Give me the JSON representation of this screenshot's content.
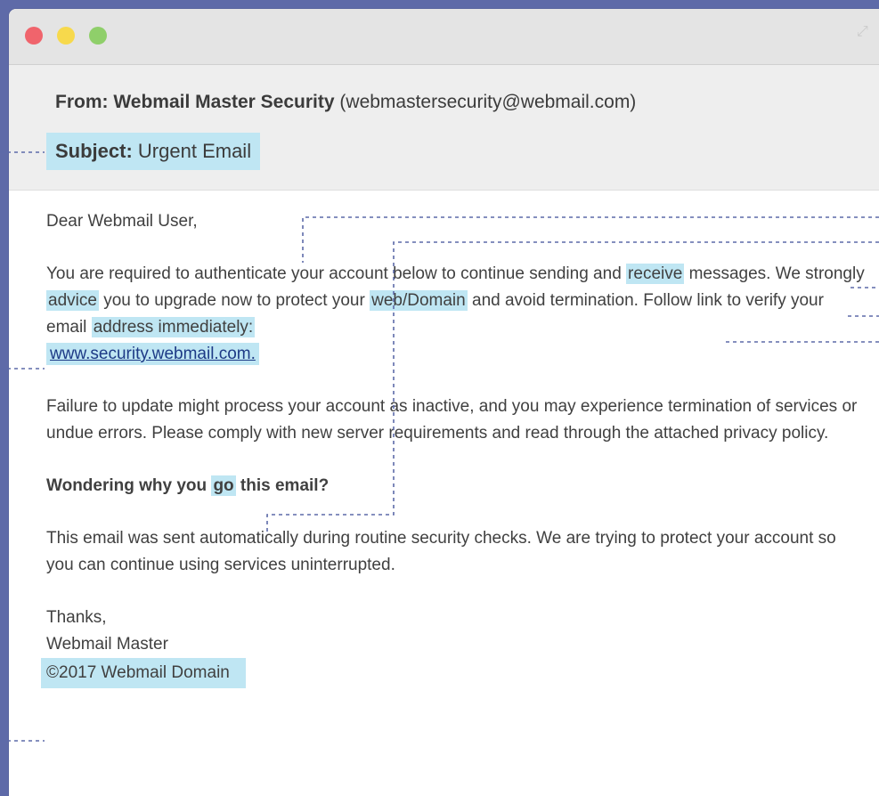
{
  "window": {
    "controls": {
      "close": "close-dot",
      "minimize": "minimize-dot",
      "zoom": "zoom-dot"
    }
  },
  "email": {
    "from_label": "From:",
    "from_name": "Webmail Master Security",
    "from_address": "(webmastersecurity@webmail.com)",
    "subject_label": "Subject:",
    "subject_value": "Urgent Email",
    "greeting": "Dear Webmail User,",
    "para1_a": "You are required to authenticate your account below to continue sending and ",
    "para1_hl1": "receive",
    "para1_b": " messages. We strongly ",
    "para1_hl2": "advice",
    "para1_c": " you to upgrade now to protect your ",
    "para1_hl3": "web/Domain",
    "para1_d": " and avoid termination. Follow link to verify your email ",
    "para1_hl4": "address immediately:",
    "link": "www.security.webmail.com.",
    "para2": "Failure to update might process your account as inactive, and you may experience termination of services or undue errors. Please comply with new server requirements and read through the attached privacy policy.",
    "question_a": "Wondering why you ",
    "question_hl": "go",
    "question_b": " this email?",
    "para3": "This email was sent automatically during routine security checks. We are trying to protect your account so you can continue using services uninterrupted.",
    "signoff": "Thanks,",
    "signature": "Webmail Master",
    "footer": "©2017 Webmail Domain"
  },
  "colors": {
    "background": "#5e6aa8",
    "highlight": "#bfe6f3",
    "link": "#1d3a86",
    "annotation_line": "#5d6aa8"
  },
  "icons": {
    "expand": "expand-icon"
  }
}
